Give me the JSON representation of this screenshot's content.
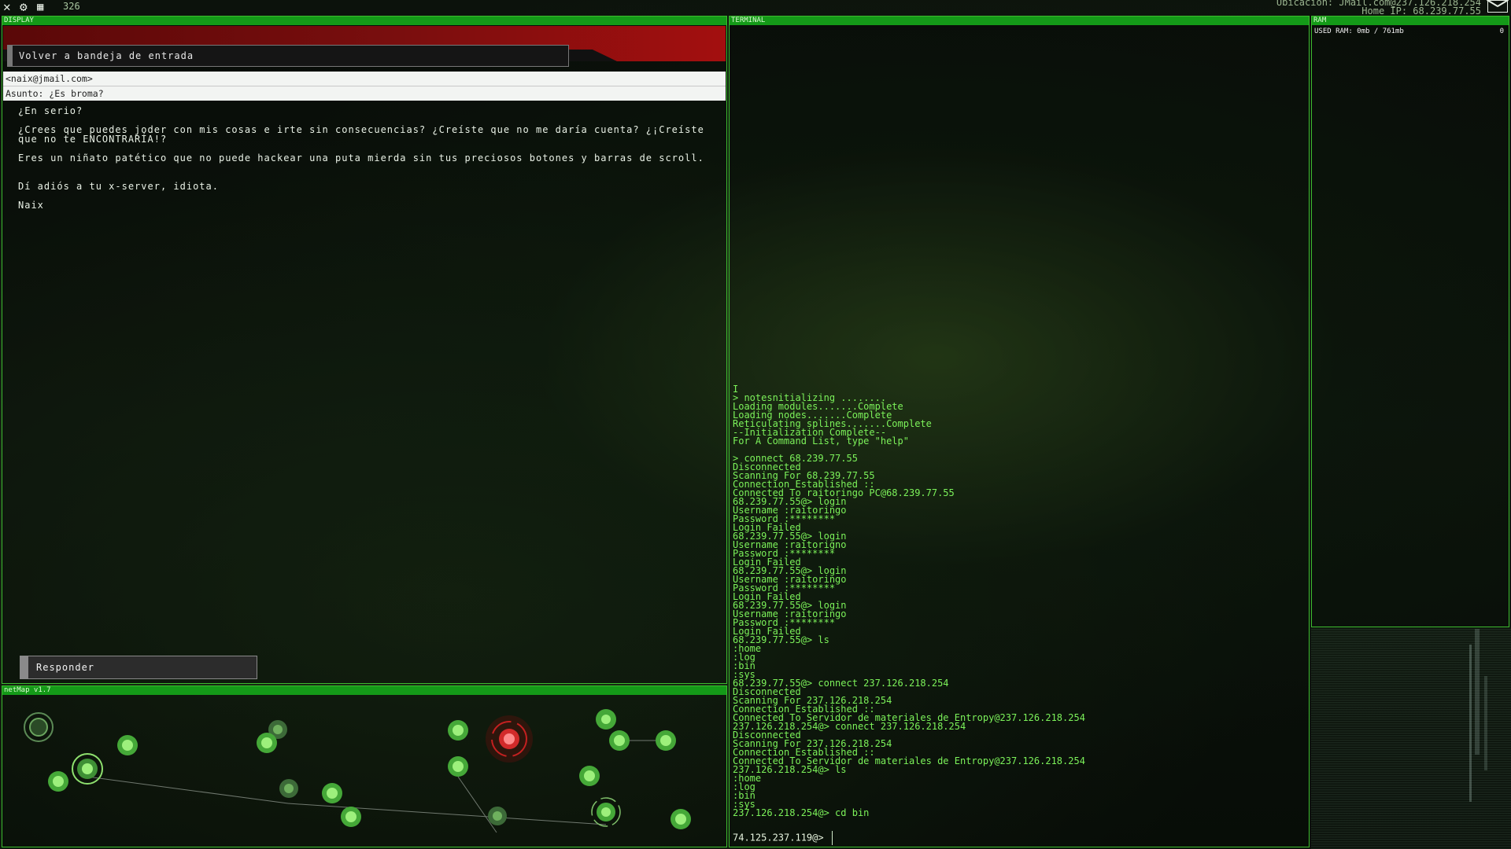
{
  "topbar": {
    "counter": "326",
    "location_line": "Ubicacion: JMail.com@237.126.218.254",
    "home_ip_line": "Home IP: 68.239.77.55"
  },
  "display": {
    "title": "DISPLAY",
    "back_button": "Volver a bandeja de entrada",
    "from": "<naix@jmail.com>",
    "subject": "Asunto: ¿Es broma?",
    "body": [
      "¿En serio?",
      "¿Crees que puedes joder con mis cosas e irte sin consecuencias? ¿Creíste que no me daría cuenta? ¿¡Creíste que no te ENCONTRARÍA!?",
      "Eres un niñato patético que no puede hackear una puta mierda sin tus preciosos botones y barras de scroll.",
      "Dí adiós a tu x-server, idiota.",
      "Naix"
    ],
    "reply_button": "Responder"
  },
  "netmap": {
    "title": "netMap v1.7"
  },
  "terminal": {
    "title": "TERMINAL",
    "lines": [
      "I",
      "> notesnitializing ........",
      "Loading modules.......Complete",
      "Loading nodes.......Complete",
      "Reticulating splines.......Complete",
      "--Initialization Complete--",
      "For A Command List, type \"help\"",
      "",
      "> connect 68.239.77.55",
      "Disconnected",
      "Scanning For 68.239.77.55",
      "Connection Established ::",
      "Connected To raitoringo PC@68.239.77.55",
      "68.239.77.55@> login",
      "Username :raitoringo",
      "Password :********",
      "Login Failed",
      "68.239.77.55@> login",
      "Username :raitorigno",
      "Password :********",
      "Login Failed",
      "68.239.77.55@> login",
      "Username :raitoringo",
      "Password :********",
      "Login Failed",
      "68.239.77.55@> login",
      "Username :raitoringo",
      "Password :********",
      "Login Failed",
      "68.239.77.55@> ls",
      ":home",
      ":log",
      ":bin",
      ":sys",
      "68.239.77.55@> connect 237.126.218.254",
      "Disconnected",
      "Scanning For 237.126.218.254",
      "Connection Established ::",
      "Connected To Servidor de materiales de Entropy@237.126.218.254",
      "237.126.218.254@> connect 237.126.218.254",
      "Disconnected",
      "Scanning For 237.126.218.254",
      "Connection Established ::",
      "Connected To Servidor de materiales de Entropy@237.126.218.254",
      "237.126.218.254@> ls",
      ":home",
      ":log",
      ":bin",
      ":sys",
      "237.126.218.254@> cd bin"
    ],
    "prompt": "74.125.237.119@>"
  },
  "ram": {
    "title": "RAM",
    "used_label": "USED RAM: 0mb / 761mb",
    "value": "0"
  }
}
